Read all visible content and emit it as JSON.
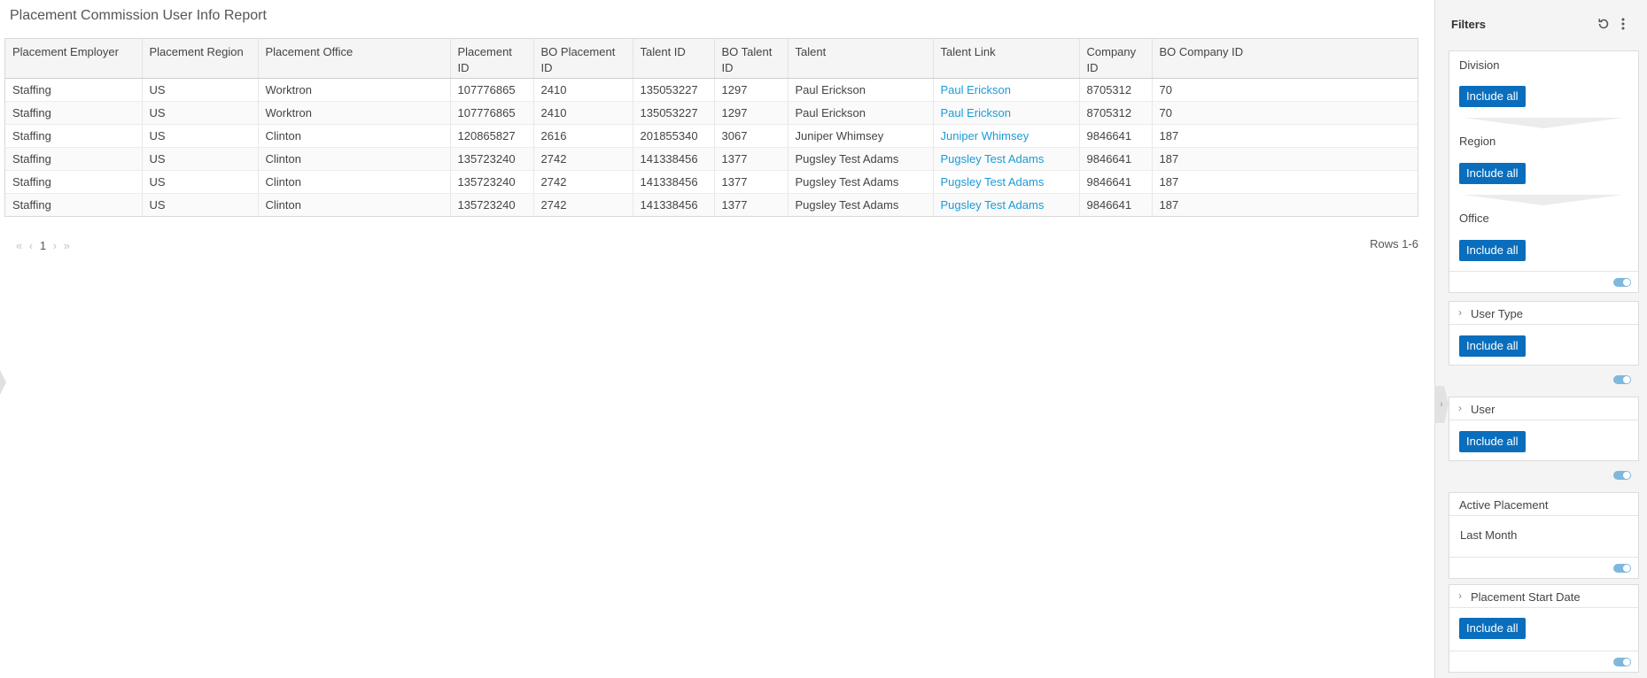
{
  "report": {
    "title": "Placement Commission User Info Report",
    "columns": [
      "Placement Employer",
      "Placement Region",
      "Placement Office",
      "Placement ID",
      "BO Placement ID",
      "Talent ID",
      "BO Talent ID",
      "Talent",
      "Talent Link",
      "Company ID",
      "BO Company ID"
    ],
    "rows": [
      [
        "Staffing",
        "US",
        "Worktron",
        "107776865",
        "2410",
        "135053227",
        "1297",
        "Paul Erickson",
        "Paul Erickson",
        "8705312",
        "70"
      ],
      [
        "Staffing",
        "US",
        "Worktron",
        "107776865",
        "2410",
        "135053227",
        "1297",
        "Paul Erickson",
        "Paul Erickson",
        "8705312",
        "70"
      ],
      [
        "Staffing",
        "US",
        "Clinton",
        "120865827",
        "2616",
        "201855340",
        "3067",
        "Juniper Whimsey",
        "Juniper Whimsey",
        "9846641",
        "187"
      ],
      [
        "Staffing",
        "US",
        "Clinton",
        "135723240",
        "2742",
        "141338456",
        "1377",
        "Pugsley Test Adams",
        "Pugsley Test Adams",
        "9846641",
        "187"
      ],
      [
        "Staffing",
        "US",
        "Clinton",
        "135723240",
        "2742",
        "141338456",
        "1377",
        "Pugsley Test Adams",
        "Pugsley Test Adams",
        "9846641",
        "187"
      ],
      [
        "Staffing",
        "US",
        "Clinton",
        "135723240",
        "2742",
        "141338456",
        "1377",
        "Pugsley Test Adams",
        "Pugsley Test Adams",
        "9846641",
        "187"
      ]
    ],
    "link_color": "#1a9bd7",
    "pager": {
      "first_icon": "«",
      "prev_icon": "‹",
      "page": "1",
      "next_icon": "›",
      "last_icon": "»"
    },
    "rows_label": "Rows 1-6"
  },
  "filters": {
    "title": "Filters",
    "reset_icon": "reset-icon",
    "more_icon": "more-vertical-icon",
    "accent_color": "#0a6ebd",
    "division_label": "Division",
    "region_label": "Region",
    "office_label": "Office",
    "include_all": "Include all",
    "user_type_label": "User Type",
    "user_label": "User",
    "active_placement_label": "Active Placement",
    "active_placement_value": "Last Month",
    "placement_start_label": "Placement Start Date",
    "chevron": "›",
    "collapse_icon": "›"
  }
}
